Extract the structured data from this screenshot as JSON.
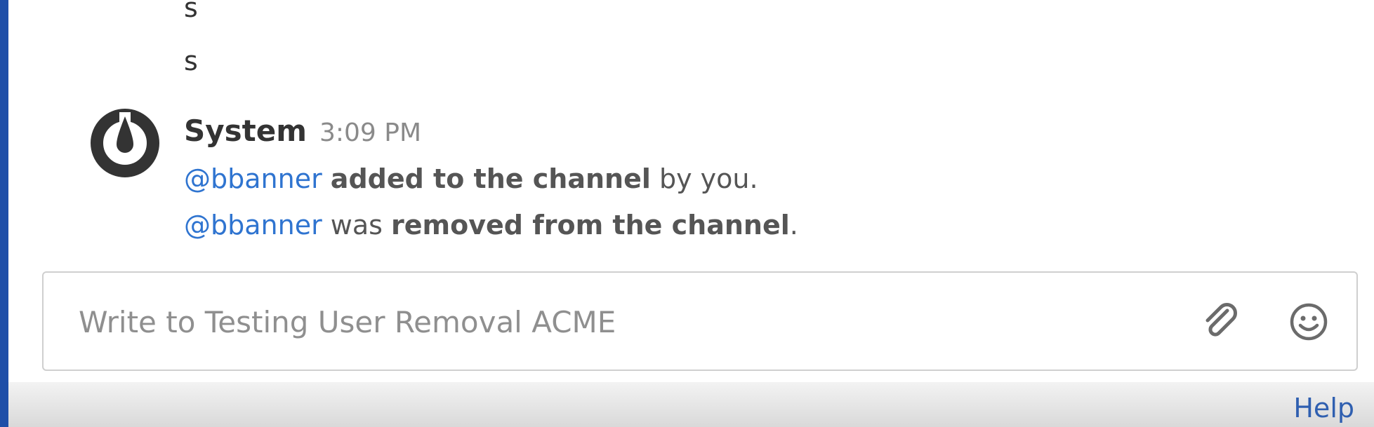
{
  "messages": {
    "prev_lines": [
      "s",
      "s"
    ],
    "system_post": {
      "username": "System",
      "timestamp": "3:09 PM",
      "line1": {
        "mention": "@bbanner",
        "bold_text": "added to the channel",
        "suffix": " by you."
      },
      "line2": {
        "mention": "@bbanner",
        "middle": " was ",
        "bold_text": "removed from the channel",
        "suffix": "."
      }
    }
  },
  "composer": {
    "placeholder": "Write to Testing User Removal ACME",
    "attach_icon": "paperclip-icon",
    "emoji_icon": "smiley-icon"
  },
  "footer": {
    "help_label": "Help"
  },
  "colors": {
    "mention": "#2f74d0",
    "sidebar": "#1f4fa8",
    "link": "#2f5fb0"
  }
}
